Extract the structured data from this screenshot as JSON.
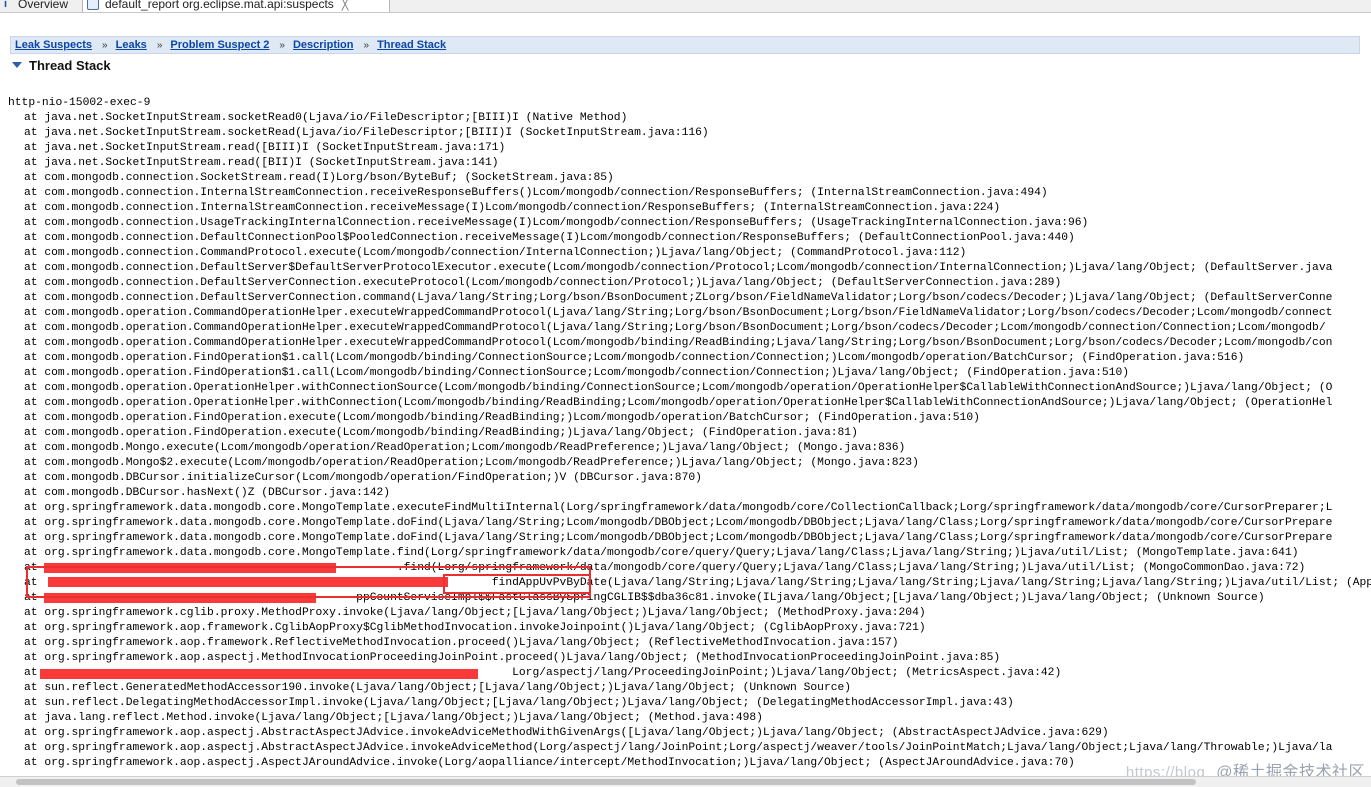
{
  "tabs": [
    {
      "label": "Overview",
      "icon": "overview-icon"
    },
    {
      "label": "default_report  org.eclipse.mat.api:suspects",
      "icon": "report-icon",
      "close": "╳"
    }
  ],
  "breadcrumb": {
    "items": [
      "Leak Suspects",
      "Leaks",
      "Problem Suspect 2",
      "Description",
      "Thread Stack"
    ],
    "separator": "»"
  },
  "section_title": "Thread Stack",
  "thread_name": "http-nio-15002-exec-9",
  "frames": [
    "at java.net.SocketInputStream.socketRead0(Ljava/io/FileDescriptor;[BIII)I (Native Method)",
    "at java.net.SocketInputStream.socketRead(Ljava/io/FileDescriptor;[BIII)I (SocketInputStream.java:116)",
    "at java.net.SocketInputStream.read([BIII)I (SocketInputStream.java:171)",
    "at java.net.SocketInputStream.read([BII)I (SocketInputStream.java:141)",
    "at com.mongodb.connection.SocketStream.read(I)Lorg/bson/ByteBuf; (SocketStream.java:85)",
    "at com.mongodb.connection.InternalStreamConnection.receiveResponseBuffers()Lcom/mongodb/connection/ResponseBuffers; (InternalStreamConnection.java:494)",
    "at com.mongodb.connection.InternalStreamConnection.receiveMessage(I)Lcom/mongodb/connection/ResponseBuffers; (InternalStreamConnection.java:224)",
    "at com.mongodb.connection.UsageTrackingInternalConnection.receiveMessage(I)Lcom/mongodb/connection/ResponseBuffers; (UsageTrackingInternalConnection.java:96)",
    "at com.mongodb.connection.DefaultConnectionPool$PooledConnection.receiveMessage(I)Lcom/mongodb/connection/ResponseBuffers; (DefaultConnectionPool.java:440)",
    "at com.mongodb.connection.CommandProtocol.execute(Lcom/mongodb/connection/InternalConnection;)Ljava/lang/Object; (CommandProtocol.java:112)",
    "at com.mongodb.connection.DefaultServer$DefaultServerProtocolExecutor.execute(Lcom/mongodb/connection/Protocol;Lcom/mongodb/connection/InternalConnection;)Ljava/lang/Object; (DefaultServer.java",
    "at com.mongodb.connection.DefaultServerConnection.executeProtocol(Lcom/mongodb/connection/Protocol;)Ljava/lang/Object; (DefaultServerConnection.java:289)",
    "at com.mongodb.connection.DefaultServerConnection.command(Ljava/lang/String;Lorg/bson/BsonDocument;ZLorg/bson/FieldNameValidator;Lorg/bson/codecs/Decoder;)Ljava/lang/Object; (DefaultServerConne",
    "at com.mongodb.operation.CommandOperationHelper.executeWrappedCommandProtocol(Ljava/lang/String;Lorg/bson/BsonDocument;Lorg/bson/FieldNameValidator;Lorg/bson/codecs/Decoder;Lcom/mongodb/connect",
    "at com.mongodb.operation.CommandOperationHelper.executeWrappedCommandProtocol(Ljava/lang/String;Lorg/bson/BsonDocument;Lorg/bson/codecs/Decoder;Lcom/mongodb/connection/Connection;Lcom/mongodb/",
    "at com.mongodb.operation.CommandOperationHelper.executeWrappedCommandProtocol(Lcom/mongodb/binding/ReadBinding;Ljava/lang/String;Lorg/bson/BsonDocument;Lorg/bson/codecs/Decoder;Lcom/mongodb/con",
    "at com.mongodb.operation.FindOperation$1.call(Lcom/mongodb/binding/ConnectionSource;Lcom/mongodb/connection/Connection;)Lcom/mongodb/operation/BatchCursor; (FindOperation.java:516)",
    "at com.mongodb.operation.FindOperation$1.call(Lcom/mongodb/binding/ConnectionSource;Lcom/mongodb/connection/Connection;)Ljava/lang/Object; (FindOperation.java:510)",
    "at com.mongodb.operation.OperationHelper.withConnectionSource(Lcom/mongodb/binding/ConnectionSource;Lcom/mongodb/operation/OperationHelper$CallableWithConnectionAndSource;)Ljava/lang/Object; (O",
    "at com.mongodb.operation.OperationHelper.withConnection(Lcom/mongodb/binding/ReadBinding;Lcom/mongodb/operation/OperationHelper$CallableWithConnectionAndSource;)Ljava/lang/Object; (OperationHel",
    "at com.mongodb.operation.FindOperation.execute(Lcom/mongodb/binding/ReadBinding;)Lcom/mongodb/operation/BatchCursor; (FindOperation.java:510)",
    "at com.mongodb.operation.FindOperation.execute(Lcom/mongodb/binding/ReadBinding;)Ljava/lang/Object; (FindOperation.java:81)",
    "at com.mongodb.Mongo.execute(Lcom/mongodb/operation/ReadOperation;Lcom/mongodb/ReadPreference;)Ljava/lang/Object; (Mongo.java:836)",
    "at com.mongodb.Mongo$2.execute(Lcom/mongodb/operation/ReadOperation;Lcom/mongodb/ReadPreference;)Ljava/lang/Object; (Mongo.java:823)",
    "at com.mongodb.DBCursor.initializeCursor(Lcom/mongodb/operation/FindOperation;)V (DBCursor.java:870)",
    "at com.mongodb.DBCursor.hasNext()Z (DBCursor.java:142)",
    "at org.springframework.data.mongodb.core.MongoTemplate.executeFindMultiInternal(Lorg/springframework/data/mongodb/core/CollectionCallback;Lorg/springframework/data/mongodb/core/CursorPreparer;L",
    "at org.springframework.data.mongodb.core.MongoTemplate.doFind(Ljava/lang/String;Lcom/mongodb/DBObject;Lcom/mongodb/DBObject;Ljava/lang/Class;Lorg/springframework/data/mongodb/core/CursorPrepare",
    "at org.springframework.data.mongodb.core.MongoTemplate.doFind(Ljava/lang/String;Lcom/mongodb/DBObject;Lcom/mongodb/DBObject;Ljava/lang/Class;Lorg/springframework/data/mongodb/core/CursorPrepare",
    "at org.springframework.data.mongodb.core.MongoTemplate.find(Lorg/springframework/data/mongodb/core/query/Query;Ljava/lang/Class;Ljava/lang/String;)Ljava/util/List; (MongoTemplate.java:641)",
    "at                                                     .find(Lorg/springframework/data/mongodb/core/query/Query;Ljava/lang/Class;Ljava/lang/String;)Ljava/util/List; (MongoCommonDao.java:72)",
    "at                                                                   findAppUvPvByDate(Ljava/lang/String;Ljava/lang/String;Ljava/lang/String;Ljava/lang/String;Ljava/lang/String;)Ljava/util/List; (AppCo",
    "at                                               ppCountServiceImpl$$FastClassBySpringCGLIB$$dba36c81.invoke(ILjava/lang/Object;[Ljava/lang/Object;)Ljava/lang/Object; (Unknown Source)",
    "at org.springframework.cglib.proxy.MethodProxy.invoke(Ljava/lang/Object;[Ljava/lang/Object;)Ljava/lang/Object; (MethodProxy.java:204)",
    "at org.springframework.aop.framework.CglibAopProxy$CglibMethodInvocation.invokeJoinpoint()Ljava/lang/Object; (CglibAopProxy.java:721)",
    "at org.springframework.aop.framework.ReflectiveMethodInvocation.proceed()Ljava/lang/Object; (ReflectiveMethodInvocation.java:157)",
    "at org.springframework.aop.aspectj.MethodInvocationProceedingJoinPoint.proceed()Ljava/lang/Object; (MethodInvocationProceedingJoinPoint.java:85)",
    "at                                                                      Lorg/aspectj/lang/ProceedingJoinPoint;)Ljava/lang/Object; (MetricsAspect.java:42)",
    "at sun.reflect.GeneratedMethodAccessor190.invoke(Ljava/lang/Object;[Ljava/lang/Object;)Ljava/lang/Object; (Unknown Source)",
    "at sun.reflect.DelegatingMethodAccessorImpl.invoke(Ljava/lang/Object;[Ljava/lang/Object;)Ljava/lang/Object; (DelegatingMethodAccessorImpl.java:43)",
    "at java.lang.reflect.Method.invoke(Ljava/lang/Object;[Ljava/lang/Object;)Ljava/lang/Object; (Method.java:498)",
    "at org.springframework.aop.aspectj.AbstractAspectJAdvice.invokeAdviceMethodWithGivenArgs([Ljava/lang/Object;)Ljava/lang/Object; (AbstractAspectJAdvice.java:629)",
    "at org.springframework.aop.aspectj.AbstractAspectJAdvice.invokeAdviceMethod(Lorg/aspectj/lang/JoinPoint;Lorg/aspectj/weaver/tools/JoinPointMatch;Ljava/lang/Object;Ljava/lang/Throwable;)Ljava/la",
    "at org.springframework.aop.aspectj.AspectJAroundAdvice.invoke(Lorg/aopalliance/intercept/MethodInvocation;)Ljava/lang/Object; (AspectJAroundAdvice.java:70)"
  ],
  "watermark": {
    "blog": "https://blog",
    "text": "@稀土掘金技术社区"
  },
  "colors": {
    "link": "#0b45a8",
    "redaction": "#fa3a3a",
    "breadcrumb_bg": "#dfe9f5"
  }
}
